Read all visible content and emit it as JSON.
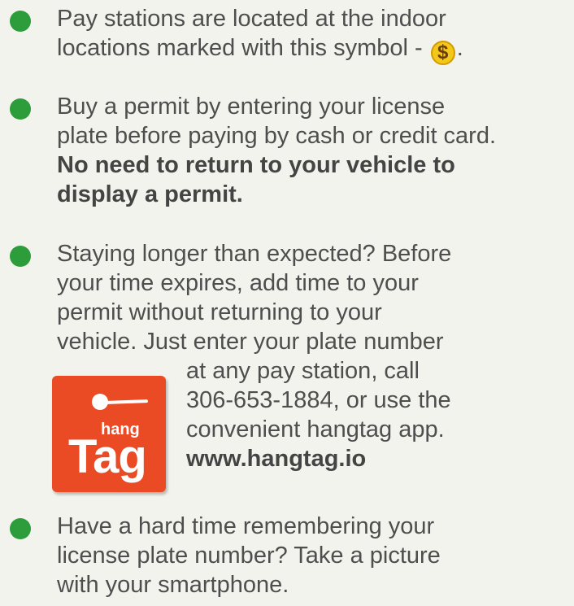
{
  "items": [
    {
      "lines": [
        "Pay stations are located at the indoor",
        "locations marked with this symbol - "
      ],
      "symbol_glyph": "$",
      "after_symbol": "."
    },
    {
      "lines": [
        "Buy a permit by entering your license",
        "plate before paying by cash or credit card."
      ],
      "bold_lines": [
        "No need to return to your vehicle to",
        "display a permit."
      ]
    },
    {
      "lines": [
        "Staying longer than expected? Before",
        "your time expires, add time to your",
        "permit without returning to your",
        "vehicle. Just enter your plate number"
      ],
      "wrap_lines": [
        "at any pay station, call",
        "306-653-1884, or use the",
        "convenient hangtag app."
      ],
      "bold_line": "www.hangtag.io"
    },
    {
      "lines": [
        "Have a hard time remembering your",
        "license plate number? Take a picture",
        "with your smartphone."
      ]
    }
  ],
  "logo": {
    "top_text": "hang",
    "main_text": "Tag"
  },
  "colors": {
    "bullet": "#2d9c3a",
    "logo_bg": "#ea4a24",
    "coin": "#f2c81a",
    "text": "#4e4e4e",
    "background": "#f3f3ee"
  },
  "icons": [
    "bullet-icon",
    "dollar-coin-icon",
    "hangtag-logo"
  ]
}
